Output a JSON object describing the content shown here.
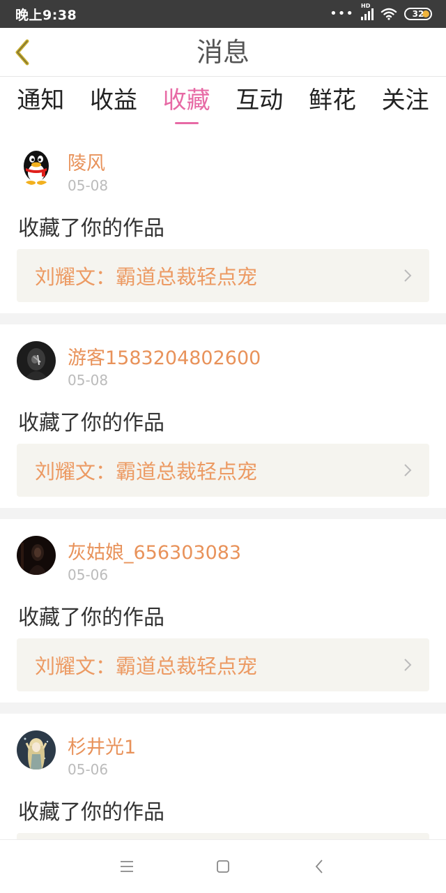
{
  "status_bar": {
    "time": "晚上9:38",
    "signal_label": "HD",
    "battery": "32"
  },
  "header": {
    "title": "消息",
    "back_icon": "chevron-left-icon"
  },
  "tabs": [
    {
      "label": "通知",
      "active": false
    },
    {
      "label": "收益",
      "active": false
    },
    {
      "label": "收藏",
      "active": true
    },
    {
      "label": "互动",
      "active": false
    },
    {
      "label": "鲜花",
      "active": false
    },
    {
      "label": "关注",
      "active": false
    }
  ],
  "colors": {
    "accent": "#e76aa5",
    "username": "#e8925a",
    "link_text": "#ec9a63",
    "link_bg": "#f5f4ef"
  },
  "messages": [
    {
      "user": "陵风",
      "date": "05-08",
      "action": "收藏了你的作品",
      "work": "刘耀文：霸道总裁轻点宠",
      "avatar": "penguin-avatar"
    },
    {
      "user": "游客1583204802600",
      "date": "05-08",
      "action": "收藏了你的作品",
      "work": "刘耀文：霸道总裁轻点宠",
      "avatar": "dark-portrait-avatar"
    },
    {
      "user": "灰姑娘_656303083",
      "date": "05-06",
      "action": "收藏了你的作品",
      "work": "刘耀文：霸道总裁轻点宠",
      "avatar": "dark-figure-avatar"
    },
    {
      "user": "杉井光1",
      "date": "05-06",
      "action": "收藏了你的作品",
      "work": "",
      "avatar": "illustrated-girl-avatar"
    }
  ],
  "nav": {
    "menu_icon": "menu-icon",
    "home_icon": "square-home-icon",
    "back_icon": "triangle-back-icon"
  }
}
